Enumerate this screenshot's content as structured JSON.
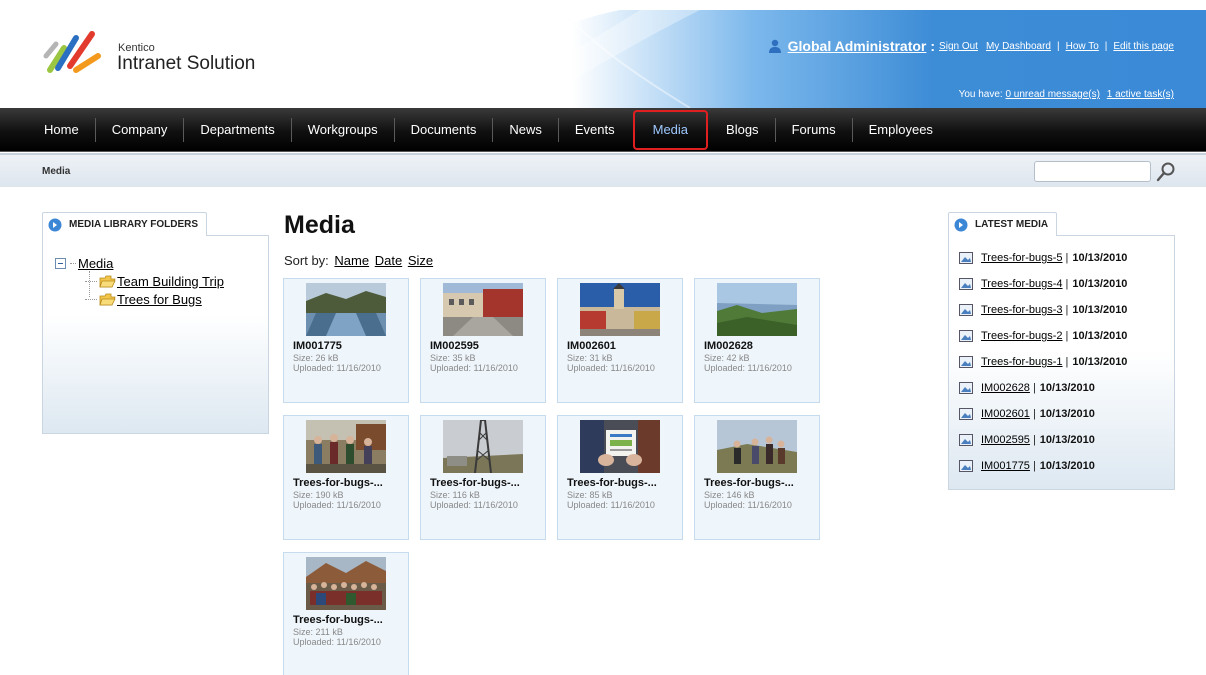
{
  "header": {
    "logo_small": "Kentico",
    "logo_big": "Intranet Solution",
    "user_name": "Global Administrator",
    "links": [
      "Sign Out",
      "My Dashboard",
      "How To",
      "Edit this page"
    ],
    "messages_prefix": "You have:",
    "unread_messages": "0 unread message(s)",
    "active_tasks": "1 active task(s)"
  },
  "nav": {
    "items": [
      "Home",
      "Company",
      "Departments",
      "Workgroups",
      "Documents",
      "News",
      "Events",
      "Media",
      "Blogs",
      "Forums",
      "Employees"
    ],
    "active": "Media"
  },
  "breadcrumb": {
    "current": "Media"
  },
  "search": {
    "value": "",
    "placeholder": ""
  },
  "folders": {
    "title": "MEDIA LIBRARY FOLDERS",
    "root": "Media",
    "children": [
      "Team Building Trip",
      "Trees for Bugs"
    ]
  },
  "main": {
    "title": "Media",
    "sort_label": "Sort by:",
    "sort_options": [
      "Name",
      "Date",
      "Size"
    ],
    "items": [
      {
        "name": "IM001775",
        "size": "Size: 26 kB",
        "uploaded": "Uploaded: 11/16/2010",
        "thumb": "river-icon"
      },
      {
        "name": "IM002595",
        "size": "Size: 35 kB",
        "uploaded": "Uploaded: 11/16/2010",
        "thumb": "street-icon"
      },
      {
        "name": "IM002601",
        "size": "Size: 31 kB",
        "uploaded": "Uploaded: 11/16/2010",
        "thumb": "town-square-icon"
      },
      {
        "name": "IM002628",
        "size": "Size: 42 kB",
        "uploaded": "Uploaded: 11/16/2010",
        "thumb": "landscape-icon"
      },
      {
        "name": "Trees-for-bugs-...",
        "size": "Size: 190 kB",
        "uploaded": "Uploaded: 11/16/2010",
        "thumb": "group-photo-icon"
      },
      {
        "name": "Trees-for-bugs-...",
        "size": "Size: 116 kB",
        "uploaded": "Uploaded: 11/16/2010",
        "thumb": "tower-icon"
      },
      {
        "name": "Trees-for-bugs-...",
        "size": "Size: 85 kB",
        "uploaded": "Uploaded: 11/16/2010",
        "thumb": "certificate-icon"
      },
      {
        "name": "Trees-for-bugs-...",
        "size": "Size: 146 kB",
        "uploaded": "Uploaded: 11/16/2010",
        "thumb": "hikers-icon"
      },
      {
        "name": "Trees-for-bugs-...",
        "size": "Size: 211 kB",
        "uploaded": "Uploaded: 11/16/2010",
        "thumb": "crowd-photo-icon"
      }
    ]
  },
  "latest": {
    "title": "LATEST MEDIA",
    "items": [
      {
        "name": "Trees-for-bugs-5",
        "date": "10/13/2010"
      },
      {
        "name": "Trees-for-bugs-4",
        "date": "10/13/2010"
      },
      {
        "name": "Trees-for-bugs-3",
        "date": "10/13/2010"
      },
      {
        "name": "Trees-for-bugs-2",
        "date": "10/13/2010"
      },
      {
        "name": "Trees-for-bugs-1",
        "date": "10/13/2010"
      },
      {
        "name": "IM002628",
        "date": "10/13/2010"
      },
      {
        "name": "IM002601",
        "date": "10/13/2010"
      },
      {
        "name": "IM002595",
        "date": "10/13/2010"
      },
      {
        "name": "IM001775",
        "date": "10/13/2010"
      }
    ]
  },
  "colors": {
    "header_blue": "#3f8fd6",
    "nav_dark": "#111111",
    "active_outline": "#e02020",
    "active_text": "#9ec8ff",
    "panel_border": "#c9d6e2",
    "card_bg": "#eef5fb"
  }
}
